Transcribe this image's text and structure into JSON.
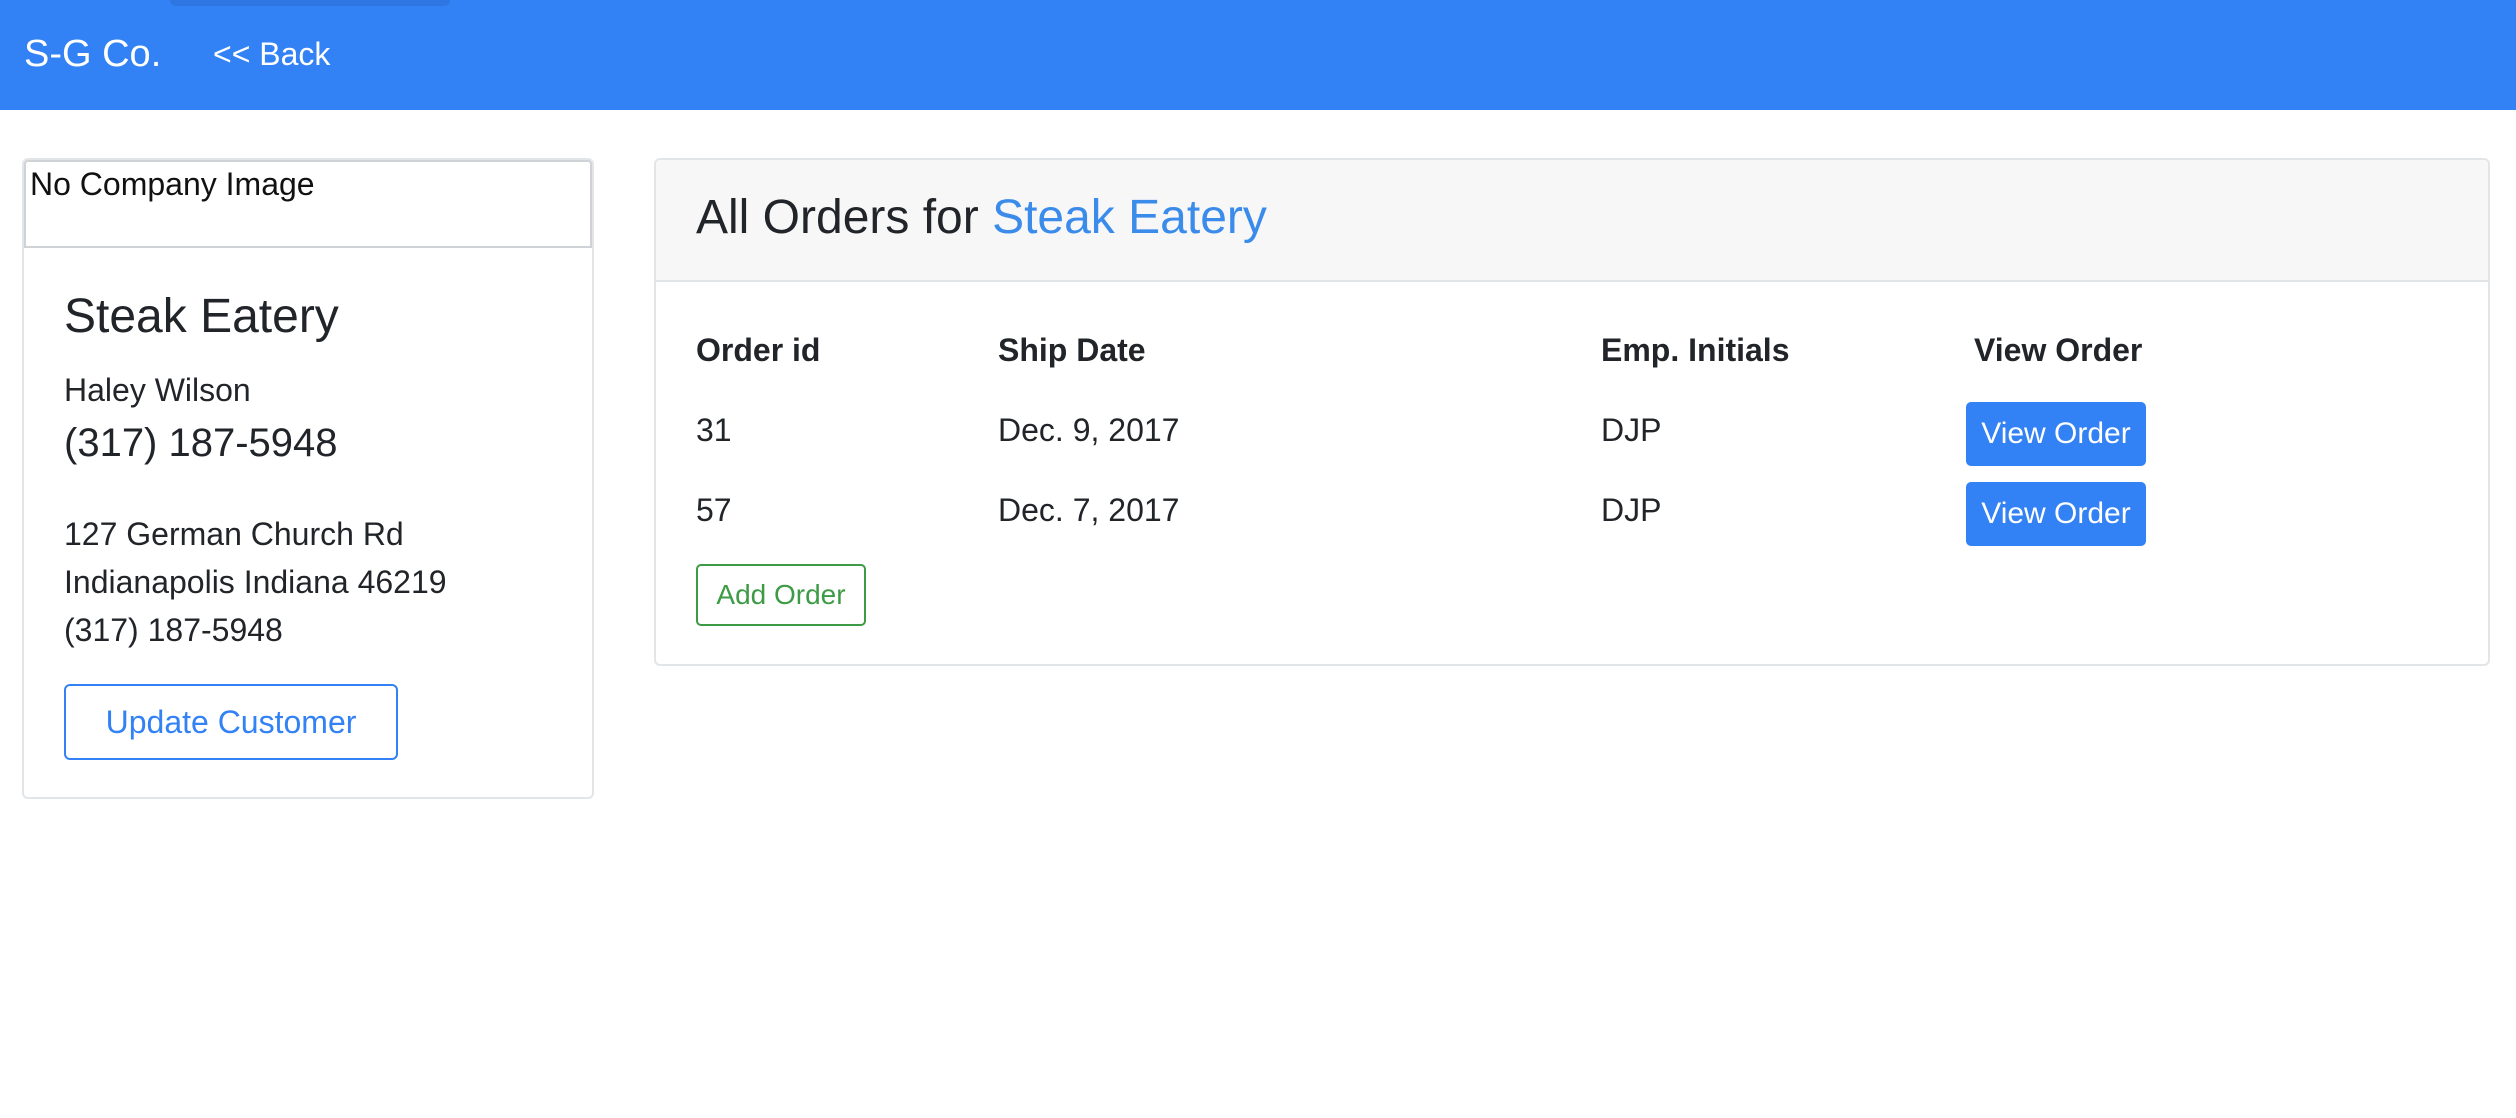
{
  "navbar": {
    "brand": "S-G Co.",
    "back_label": "<< Back"
  },
  "customer": {
    "image_alt": "No Company Image",
    "name": "Steak Eatery",
    "contact_name": "Haley Wilson",
    "contact_phone": "(317) 187-5948",
    "address_line1": "127 German Church Rd",
    "address_line2": "Indianapolis Indiana 46219",
    "address_phone": "(317) 187-5948",
    "update_label": "Update Customer"
  },
  "orders": {
    "title_prefix": "All Orders for ",
    "title_customer": "Steak Eatery",
    "columns": [
      "Order id",
      "Ship Date",
      "Emp. Initials",
      "View Order"
    ],
    "rows": [
      {
        "order_id": "31",
        "ship_date": "Dec. 9, 2017",
        "emp_initials": "DJP",
        "view_label": "View Order"
      },
      {
        "order_id": "57",
        "ship_date": "Dec. 7, 2017",
        "emp_initials": "DJP",
        "view_label": "View Order"
      }
    ],
    "add_label": "Add Order"
  },
  "colors": {
    "navbar": "#3281f5",
    "accent": "#3b8beb",
    "success": "#3e9b45"
  }
}
